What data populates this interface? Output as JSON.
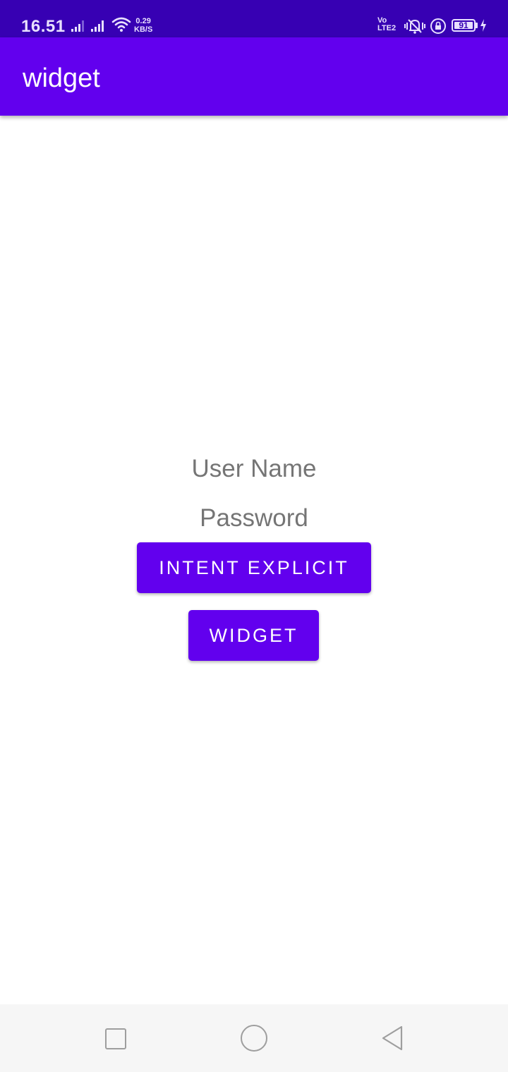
{
  "status_bar": {
    "time": "16.51",
    "net_speed_value": "0.29",
    "net_speed_unit": "KB/S",
    "volte_top": "Vo",
    "volte_bottom": "LTE2",
    "battery_level": "91",
    "icons": [
      "signal-icon",
      "signal-icon",
      "wifi-icon",
      "volte-icon",
      "vibrate-icon",
      "rotation-lock-icon",
      "battery-icon",
      "charging-bolt-icon"
    ]
  },
  "app_bar": {
    "title": "widget",
    "color": "#6200ee",
    "status_color": "#3700b3"
  },
  "form": {
    "username_hint": "User Name",
    "password_hint": "Password",
    "hint_color": "#757575"
  },
  "buttons": {
    "intent_explicit": "INTENT EXPLICIT",
    "widget": "WIDGET",
    "color": "#6200ee"
  },
  "nav_bar": {
    "icons": [
      "recents-icon",
      "home-icon",
      "back-icon"
    ]
  }
}
